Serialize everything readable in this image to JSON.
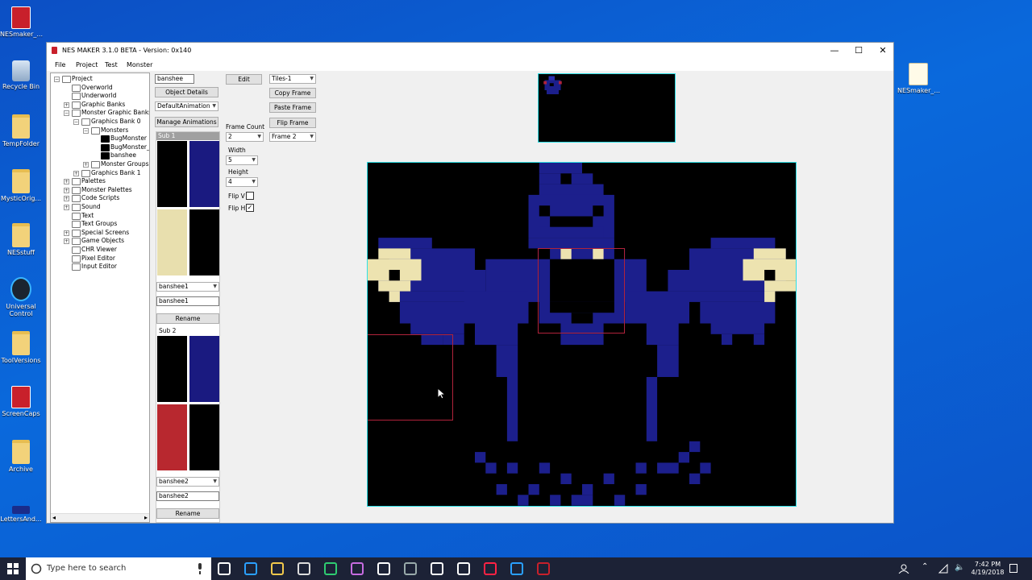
{
  "desktop": {
    "icons": [
      {
        "label": "NESmaker_...",
        "icon": "nesmaker-app-icon"
      },
      {
        "label": "Recycle Bin",
        "icon": "recycle-bin-icon"
      },
      {
        "label": "TempFolder",
        "icon": "folder-icon"
      },
      {
        "label": "MysticOrig...",
        "icon": "folder-icon"
      },
      {
        "label": "NESstuff",
        "icon": "folder-icon"
      },
      {
        "label": "Universal Control",
        "icon": "universal-control-icon"
      },
      {
        "label": "ToolVersions",
        "icon": "folder-icon"
      },
      {
        "label": "ScreenCaps",
        "icon": "nesmaker-app-icon"
      },
      {
        "label": "Archive",
        "icon": "folder-icon"
      },
      {
        "label": "LettersAnd...",
        "icon": "image-file-icon"
      }
    ],
    "right_icon": {
      "label": "NESmaker_...",
      "icon": "document-icon"
    }
  },
  "window": {
    "title": "NES MAKER 3.1.0 BETA - Version: 0x140",
    "menu": [
      "File",
      "Project",
      "Test",
      "Monster"
    ],
    "controls": {
      "minimize": "—",
      "maximize": "☐",
      "close": "✕"
    }
  },
  "tree": [
    {
      "label": "Project",
      "level": 0,
      "expander": "−"
    },
    {
      "label": "Overworld",
      "level": 1,
      "expander": ""
    },
    {
      "label": "Underworld",
      "level": 1,
      "expander": ""
    },
    {
      "label": "Graphic Banks",
      "level": 1,
      "expander": "+"
    },
    {
      "label": "Monster Graphic Banks",
      "level": 1,
      "expander": "−"
    },
    {
      "label": "Graphics Bank 0",
      "level": 2,
      "expander": "−"
    },
    {
      "label": "Monsters",
      "level": 3,
      "expander": "−"
    },
    {
      "label": "BugMonster",
      "level": 4,
      "expander": ""
    },
    {
      "label": "BugMonster_Fr",
      "level": 4,
      "expander": ""
    },
    {
      "label": "banshee",
      "level": 4,
      "expander": ""
    },
    {
      "label": "Monster Groups",
      "level": 3,
      "expander": "+"
    },
    {
      "label": "Graphics Bank 1",
      "level": 2,
      "expander": "+"
    },
    {
      "label": "Palettes",
      "level": 1,
      "expander": "+"
    },
    {
      "label": "Monster Palettes",
      "level": 1,
      "expander": "+"
    },
    {
      "label": "Code Scripts",
      "level": 1,
      "expander": "+"
    },
    {
      "label": "Sound",
      "level": 1,
      "expander": "+"
    },
    {
      "label": "Text",
      "level": 1,
      "expander": ""
    },
    {
      "label": "Text Groups",
      "level": 1,
      "expander": ""
    },
    {
      "label": "Special Screens",
      "level": 1,
      "expander": "+"
    },
    {
      "label": "Game Objects",
      "level": 1,
      "expander": "+"
    },
    {
      "label": "CHR Viewer",
      "level": 1,
      "expander": ""
    },
    {
      "label": "Pixel Editor",
      "level": 1,
      "expander": ""
    },
    {
      "label": "Input Editor",
      "level": 1,
      "expander": ""
    }
  ],
  "editor": {
    "name_input": "banshee",
    "object_details": "Object Details",
    "animation_select": "DefaultAnimation",
    "manage_animations": "Manage Animations",
    "sub1": {
      "header": "Sub 1",
      "colors": [
        "#000000",
        "#1a1a80",
        "#e8dfae",
        "#000000"
      ],
      "select": "banshee1",
      "input": "banshee1",
      "rename": "Rename"
    },
    "sub2": {
      "header": "Sub 2",
      "colors": [
        "#000000",
        "#1a1a80",
        "#b8282f",
        "#000000"
      ],
      "select": "banshee2",
      "input": "banshee2",
      "rename": "Rename"
    },
    "edit": "Edit",
    "tiles_select": "Tiles-1",
    "copy_frame": "Copy Frame",
    "paste_frame": "Paste Frame",
    "flip_frame": "Flip Frame",
    "frame_count_label": "Frame Count",
    "frame_count": "2",
    "frame_select": "Frame 2",
    "width_label": "Width",
    "width": "5",
    "height_label": "Height",
    "height": "4",
    "flip_v_label": "Flip V",
    "flip_v": false,
    "flip_h_label": "Flip H",
    "flip_h": true
  },
  "sprite": {
    "colors": {
      "blue": "#1c1f8c",
      "cream": "#ede3b0",
      "red": "#b1233b",
      "cyan": "#2ee0e6"
    }
  },
  "taskbar": {
    "search_placeholder": "Type here to search",
    "time": "7:42 PM",
    "date": "4/19/2018"
  }
}
